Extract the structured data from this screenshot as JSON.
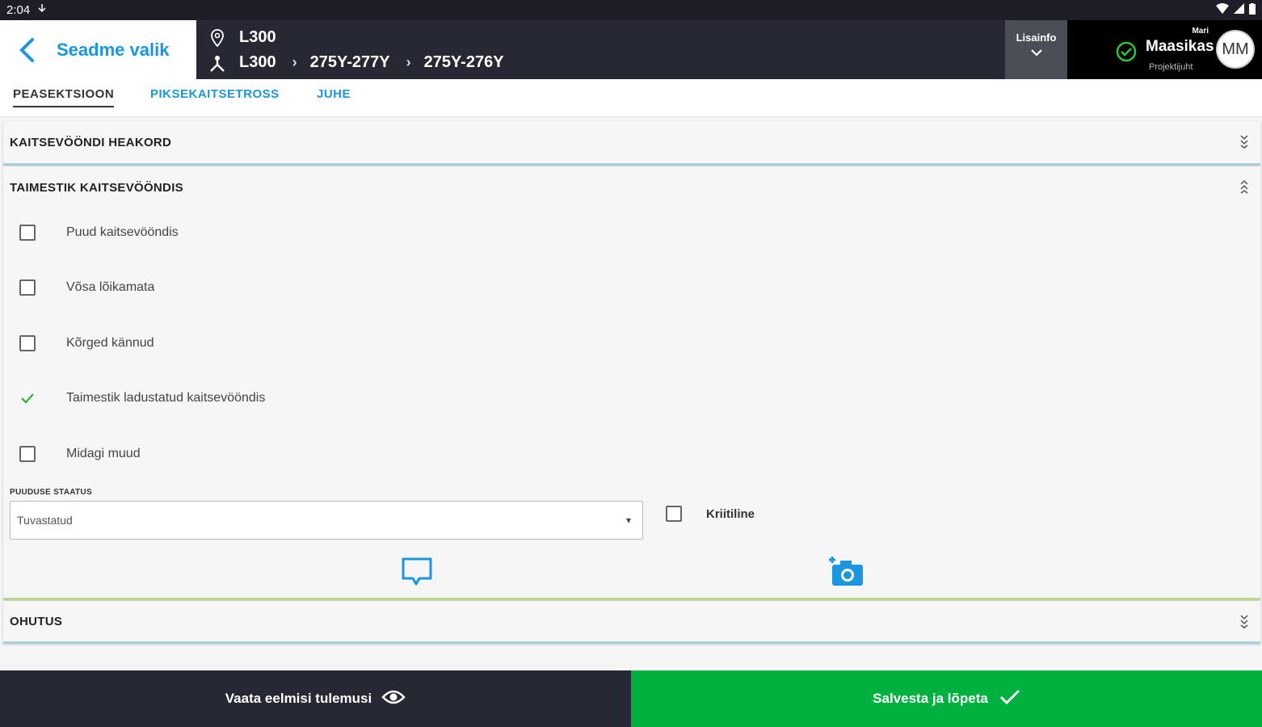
{
  "status_bar": {
    "time": "2:04"
  },
  "header": {
    "back_label": "Seadme valik",
    "location": "L300",
    "path": [
      "L300",
      "275Y-277Y",
      "275Y-276Y"
    ],
    "info_button": "Lisainfo",
    "user": {
      "first_name": "Mari",
      "last_name": "Maasikas",
      "role": "Projektijuht",
      "initials": "MM"
    }
  },
  "tabs": [
    {
      "label": "PEASEKTSIOON",
      "active": true
    },
    {
      "label": "PIKSEKAITSETROSS",
      "active": false
    },
    {
      "label": "JUHE",
      "active": false
    }
  ],
  "sections": {
    "s1": {
      "title": "KAITSEVÖÖNDI HEAKORD"
    },
    "s2": {
      "title": "TAIMESTIK KAITSEVÖÖNDIS",
      "items": [
        {
          "label": "Puud kaitsevööndis",
          "checked": false
        },
        {
          "label": "Võsa lõikamata",
          "checked": false
        },
        {
          "label": "Kõrged kännud",
          "checked": false
        },
        {
          "label": "Taimestik ladustatud kaitsevööndis",
          "checked": true
        },
        {
          "label": "Midagi muud",
          "checked": false
        }
      ],
      "status_label": "PUUDUSE STAATUS",
      "status_value": "Tuvastatud",
      "critical_label": "Kriitiline"
    },
    "s3": {
      "title": "OHUTUS"
    }
  },
  "footer": {
    "previous_label": "Vaata eelmisi tulemusi",
    "save_label": "Salvesta ja lõpeta"
  },
  "colors": {
    "accent": "#1a96e0",
    "success": "#00b140",
    "dark": "#262933"
  }
}
